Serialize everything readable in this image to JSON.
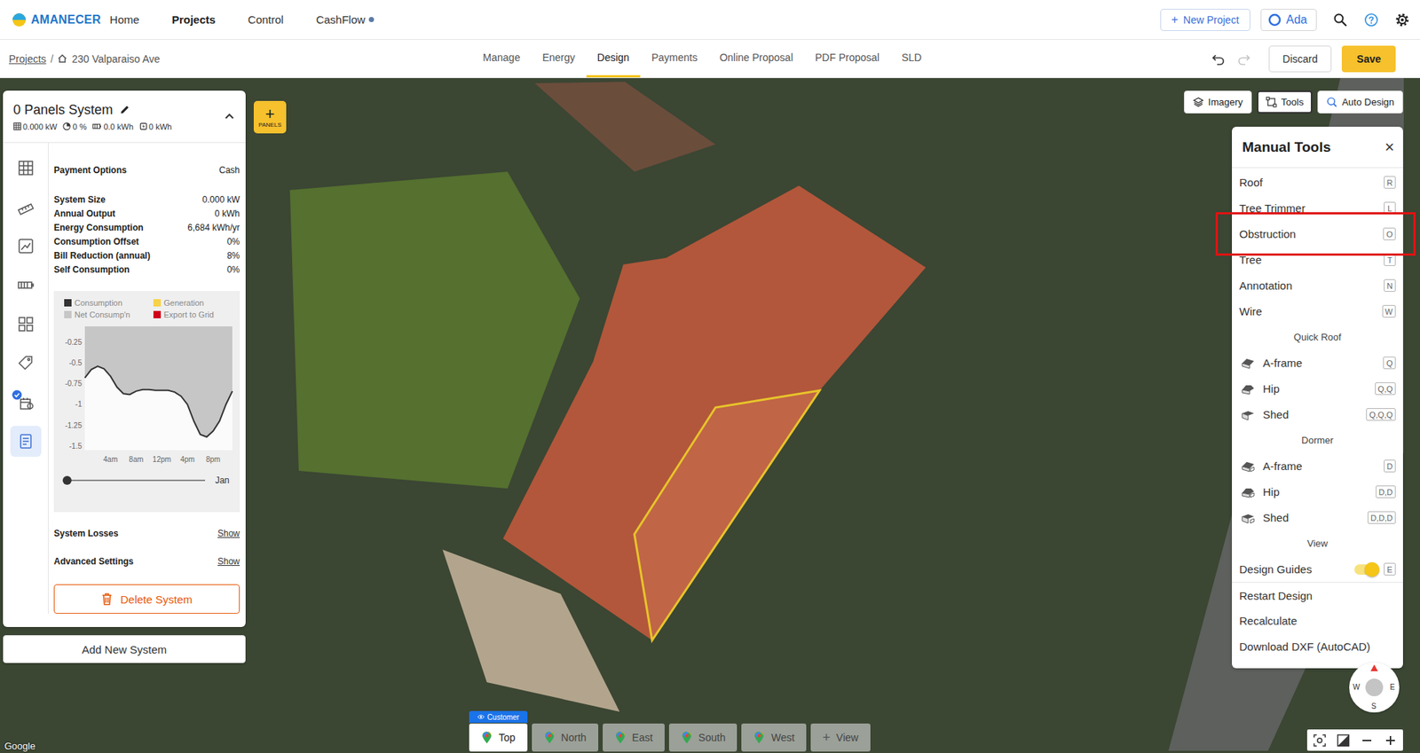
{
  "brand": {
    "name": "AMANECER"
  },
  "nav": [
    {
      "label": "Home",
      "selected": false,
      "dot": false
    },
    {
      "label": "Projects",
      "selected": true,
      "dot": false
    },
    {
      "label": "Control",
      "selected": false,
      "dot": false
    },
    {
      "label": "CashFlow",
      "selected": false,
      "dot": true
    }
  ],
  "header_actions": {
    "new_project": {
      "icon": "+",
      "label": "New Project"
    },
    "user": {
      "label": "Ada"
    }
  },
  "breadcrumb": {
    "root": "Projects",
    "separator": "/",
    "current": "230 Valparaiso Ave"
  },
  "tabs": [
    {
      "label": "Manage",
      "selected": false
    },
    {
      "label": "Energy",
      "selected": false
    },
    {
      "label": "Design",
      "selected": true
    },
    {
      "label": "Payments",
      "selected": false
    },
    {
      "label": "Online Proposal",
      "selected": false
    },
    {
      "label": "PDF Proposal",
      "selected": false
    },
    {
      "label": "SLD",
      "selected": false
    }
  ],
  "history": {
    "undo_enabled": true,
    "redo_enabled": false
  },
  "actions": {
    "discard": "Discard",
    "save": "Save"
  },
  "system_panel": {
    "title": "0 Panels System",
    "expanded": true,
    "stats": [
      {
        "value": "0.000 kW"
      },
      {
        "value": "0 %"
      },
      {
        "value": "0.0 kWh"
      },
      {
        "value": "0 kWh"
      }
    ],
    "rail": [
      {
        "selected": false,
        "badge": false
      },
      {
        "selected": false,
        "badge": false
      },
      {
        "selected": false,
        "badge": false
      },
      {
        "selected": false,
        "badge": false
      },
      {
        "selected": false,
        "badge": false
      },
      {
        "selected": false,
        "badge": false
      },
      {
        "selected": false,
        "badge": true
      },
      {
        "selected": true,
        "badge": false
      }
    ],
    "payment": {
      "label": "Payment Options",
      "value": "Cash"
    },
    "metrics": [
      {
        "label": "System Size",
        "value": "0.000 kW"
      },
      {
        "label": "Annual Output",
        "value": "0 kWh"
      },
      {
        "label": "Energy Consumption",
        "value": "6,684 kWh/yr"
      },
      {
        "label": "Consumption Offset",
        "value": "0%"
      },
      {
        "label": "Bill Reduction (annual)",
        "value": "8%"
      },
      {
        "label": "Self Consumption",
        "value": "0%"
      }
    ],
    "chart": {
      "legend": [
        {
          "label": "Consumption",
          "color": "#333333"
        },
        {
          "label": "Generation",
          "color": "#f7d24a"
        },
        {
          "label": "Net Consump'n",
          "color": "#c6c6c6"
        },
        {
          "label": "Export to Grid",
          "color": "#d0021b"
        }
      ],
      "y_ticks": [
        "-0.25",
        "-0.5",
        "-0.75",
        "-1",
        "-1.25",
        "-1.5"
      ],
      "x_ticks": [
        "4am",
        "8am",
        "12pm",
        "4pm",
        "8pm"
      ],
      "series": [
        {
          "name": "Consumption",
          "values": [
            -0.68,
            -0.58,
            -0.54,
            -0.57,
            -0.66,
            -0.79,
            -0.87,
            -0.88,
            -0.84,
            -0.82,
            -0.82,
            -0.83,
            -0.83,
            -0.83,
            -0.85,
            -0.9,
            -1.0,
            -1.2,
            -1.36,
            -1.39,
            -1.32,
            -1.2,
            -1.0,
            -0.84
          ]
        },
        {
          "name": "Net Consump'n",
          "values": [
            -0.68,
            -0.58,
            -0.54,
            -0.57,
            -0.66,
            -0.79,
            -0.87,
            -0.88,
            -0.84,
            -0.82,
            -0.82,
            -0.83,
            -0.83,
            -0.83,
            -0.85,
            -0.9,
            -1.0,
            -1.2,
            -1.36,
            -1.39,
            -1.32,
            -1.2,
            -1.0,
            -0.84
          ]
        }
      ]
    },
    "month_slider": {
      "level": 0,
      "label": "Jan"
    },
    "links": [
      {
        "label": "System Losses",
        "action": "Show"
      },
      {
        "label": "Advanced Settings",
        "action": "Show"
      }
    ],
    "delete": "Delete System"
  },
  "add_system": "Add New System",
  "panels_button": {
    "icon": "+",
    "label": "PANELS"
  },
  "map_buttons": [
    {
      "label": "Imagery",
      "selected": false
    },
    {
      "label": "Tools",
      "selected": true
    },
    {
      "label": "Auto Design",
      "selected": false
    }
  ],
  "manual_tools": {
    "title": "Manual Tools",
    "close": "×",
    "items": [
      {
        "kind": "tool",
        "label": "Roof",
        "key": "R",
        "highlighted": false
      },
      {
        "kind": "tool",
        "label": "Tree Trimmer",
        "key": "L",
        "highlighted": false
      },
      {
        "kind": "tool",
        "label": "Obstruction",
        "key": "O",
        "highlighted": true
      },
      {
        "kind": "tool",
        "label": "Tree",
        "key": "T",
        "highlighted": false
      },
      {
        "kind": "tool",
        "label": "Annotation",
        "key": "N",
        "highlighted": false
      },
      {
        "kind": "tool",
        "label": "Wire",
        "key": "W",
        "highlighted": false
      },
      {
        "kind": "heading",
        "label": "Quick Roof"
      },
      {
        "kind": "roof",
        "label": "A-frame",
        "key": "Q",
        "highlighted": false
      },
      {
        "kind": "roof",
        "label": "Hip",
        "key": "Q,Q",
        "highlighted": false
      },
      {
        "kind": "roof",
        "label": "Shed",
        "key": "Q,Q,Q",
        "highlighted": false
      },
      {
        "kind": "heading",
        "label": "Dormer"
      },
      {
        "kind": "dormer",
        "label": "A-frame",
        "key": "D",
        "highlighted": false
      },
      {
        "kind": "dormer",
        "label": "Hip",
        "key": "D,D",
        "highlighted": false
      },
      {
        "kind": "dormer",
        "label": "Shed",
        "key": "D,D,D",
        "highlighted": false
      },
      {
        "kind": "heading",
        "label": "View"
      },
      {
        "kind": "toggle",
        "label": "Design Guides",
        "key": "E",
        "on": true
      },
      {
        "kind": "action",
        "label": "Restart Design"
      },
      {
        "kind": "action",
        "label": "Recalculate"
      },
      {
        "kind": "action",
        "label": "Download DXF (AutoCAD)"
      }
    ]
  },
  "view_tabs": [
    {
      "kind": "view",
      "label": "Top",
      "selected": true,
      "badge": "Customer"
    },
    {
      "kind": "view",
      "label": "North",
      "selected": false,
      "badge": ""
    },
    {
      "kind": "view",
      "label": "East",
      "selected": false,
      "badge": ""
    },
    {
      "kind": "view",
      "label": "South",
      "selected": false,
      "badge": ""
    },
    {
      "kind": "view",
      "label": "West",
      "selected": false,
      "badge": ""
    },
    {
      "kind": "add",
      "icon": "+",
      "label": "View",
      "selected": false,
      "badge": ""
    }
  ],
  "compass": {
    "west": "W",
    "east": "E",
    "south": "S"
  },
  "attribution": "Google"
}
